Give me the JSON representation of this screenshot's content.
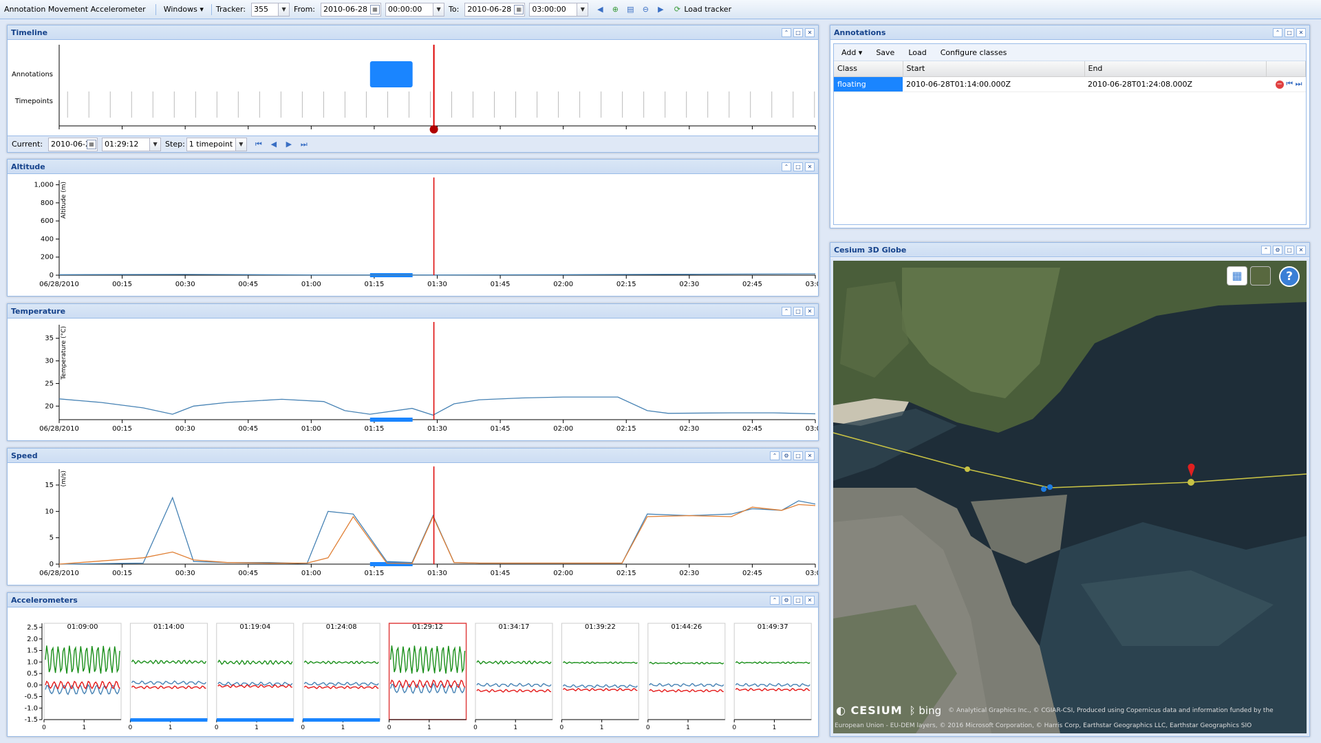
{
  "toolbar": {
    "app_title": "Annotation Movement Accelerometer",
    "windows_label": "Windows",
    "tracker_label": "Tracker:",
    "tracker_value": "355",
    "from_label": "From:",
    "from_date": "2010-06-28",
    "from_time": "00:00:00",
    "to_label": "To:",
    "to_date": "2010-06-28",
    "to_time": "03:00:00",
    "load_tracker_label": "Load tracker"
  },
  "panels": {
    "timeline": "Timeline",
    "altitude": "Altitude",
    "temperature": "Temperature",
    "speed": "Speed",
    "accelerometers": "Accelerometers",
    "annotations": "Annotations",
    "globe": "Cesium 3D Globe"
  },
  "timeline": {
    "row_labels": [
      "Annotations",
      "Timepoints"
    ],
    "time_ticks": [
      "06/28/2010",
      "00:15",
      "00:30",
      "00:45",
      "01:00",
      "01:15",
      "01:30",
      "01:45",
      "02:00",
      "02:15",
      "02:30",
      "02:45",
      "03:00"
    ],
    "current_label": "Current:",
    "current_date": "2010-06-28",
    "current_time": "01:29:12",
    "step_label": "Step:",
    "step_value": "1 timepoint",
    "cursor_minutes": 89.2,
    "annotation_start_minutes": 74,
    "annotation_end_minutes": 84.13
  },
  "charts": {
    "altitude": {
      "type": "line",
      "ylabel": "Altitude (m)",
      "y_ticks": [
        "0",
        "200",
        "400",
        "600",
        "800",
        "1,000"
      ],
      "ylim": [
        0,
        1050
      ],
      "x_minutes": [
        0,
        30,
        60,
        90,
        105,
        120,
        150,
        180
      ],
      "series": [
        {
          "values": [
            5,
            8,
            3,
            2,
            4,
            5,
            10,
            15
          ],
          "color": "#4682b4"
        }
      ]
    },
    "temperature": {
      "type": "line",
      "ylabel": "Temperature (°C)",
      "y_ticks": [
        "20",
        "25",
        "30",
        "35"
      ],
      "ylim": [
        17,
        38
      ],
      "x_minutes": [
        0,
        10,
        20,
        27,
        32,
        40,
        53,
        63,
        68,
        74,
        84,
        89,
        94,
        100,
        110,
        120,
        133,
        140,
        145,
        160,
        170,
        180
      ],
      "series": [
        {
          "values": [
            21.6,
            20.8,
            19.6,
            18.2,
            20.0,
            20.8,
            21.5,
            21.0,
            19.0,
            18.2,
            19.5,
            18.0,
            20.5,
            21.4,
            21.8,
            22.0,
            22.0,
            19.0,
            18.4,
            18.5,
            18.5,
            18.3
          ],
          "color": "#4682b4"
        }
      ]
    },
    "speed": {
      "type": "line",
      "ylabel": "(m/s)",
      "y_ticks": [
        "0",
        "5",
        "10",
        "15"
      ],
      "ylim": [
        0,
        18
      ],
      "x_minutes": [
        0,
        20,
        27,
        32,
        40,
        50,
        59,
        64,
        70,
        78,
        84,
        89,
        94,
        100,
        110,
        120,
        134,
        140,
        150,
        160,
        165,
        172,
        176,
        180
      ],
      "series": [
        {
          "values": [
            0,
            0.2,
            12.6,
            0.5,
            0.3,
            0.3,
            0.1,
            10.0,
            9.5,
            0.5,
            0.3,
            9.2,
            0.3,
            0.2,
            0.2,
            0.2,
            0.2,
            9.5,
            9.2,
            9.5,
            10.5,
            10.2,
            12.0,
            11.4
          ],
          "color": "#4682b4"
        },
        {
          "values": [
            0,
            1.2,
            2.3,
            0.8,
            0.3,
            0.2,
            0.2,
            1.2,
            9.0,
            0.2,
            0.1,
            9.0,
            0.3,
            0.2,
            0.2,
            0.2,
            0.2,
            9.0,
            9.2,
            9.0,
            10.8,
            10.2,
            11.3,
            11.1
          ],
          "color": "#e07f34"
        }
      ]
    }
  },
  "annotation_bars_minutes": [
    [
      74,
      84.13
    ]
  ],
  "accelerometers": {
    "y_ticks": [
      "2.5",
      "2.0",
      "1.5",
      "1.0",
      "0.5",
      "0.0",
      "-0.5",
      "-1.0",
      "-1.5"
    ],
    "x_ticks": [
      "0",
      "1"
    ],
    "selected_index": 4,
    "cells": [
      {
        "time": "01:09:00",
        "green_level": 1.1,
        "green_osc": 0.6,
        "blue_level": -0.2,
        "red_level": 0.0,
        "annotated": false
      },
      {
        "time": "01:14:00",
        "green_level": 1.0,
        "green_osc": 0.06,
        "blue_level": 0.1,
        "red_level": -0.1,
        "annotated": true
      },
      {
        "time": "01:19:04",
        "green_level": 0.98,
        "green_osc": 0.07,
        "blue_level": 0.05,
        "red_level": -0.05,
        "annotated": true
      },
      {
        "time": "01:24:08",
        "green_level": 0.98,
        "green_osc": 0.04,
        "blue_level": 0.05,
        "red_level": -0.1,
        "annotated": true
      },
      {
        "time": "01:29:12",
        "green_level": 1.1,
        "green_osc": 0.6,
        "blue_level": -0.15,
        "red_level": 0.05,
        "annotated": false
      },
      {
        "time": "01:34:17",
        "green_level": 0.98,
        "green_osc": 0.05,
        "blue_level": 0.0,
        "red_level": -0.25,
        "annotated": false
      },
      {
        "time": "01:39:22",
        "green_level": 0.97,
        "green_osc": 0.02,
        "blue_level": -0.05,
        "red_level": -0.2,
        "annotated": false
      },
      {
        "time": "01:44:26",
        "green_level": 0.95,
        "green_osc": 0.02,
        "blue_level": 0.0,
        "red_level": -0.25,
        "annotated": false
      },
      {
        "time": "01:49:37",
        "green_level": 0.97,
        "green_osc": 0.02,
        "blue_level": 0.0,
        "red_level": -0.2,
        "annotated": false
      }
    ]
  },
  "annotations_panel": {
    "add_label": "Add",
    "save_label": "Save",
    "load_label": "Load",
    "configure_label": "Configure classes",
    "columns": [
      "Class",
      "Start",
      "End"
    ],
    "rows": [
      {
        "class": "floating",
        "start": "2010-06-28T01:14:00.000Z",
        "end": "2010-06-28T01:24:08.000Z"
      }
    ]
  },
  "globe": {
    "cesium_label": "CESIUM",
    "bing_label": "bing",
    "attribution_1": "© Analytical Graphics Inc., © CGIAR-CSI, Produced using Copernicus data and information funded by the",
    "attribution_2": "European Union - EU-DEM layers, © 2016 Microsoft Corporation, © Harris Corp, Earthstar Geographics LLC, Earthstar Geographics SIO",
    "help_label": "?"
  },
  "colors": {
    "accent": "#1a85ff",
    "cursor": "#dd0000",
    "blue_series": "#4682b4",
    "orange_series": "#e07f34",
    "header_text": "#15428b",
    "acc_green": "#1a8f1a",
    "acc_red": "#e41a1a"
  }
}
